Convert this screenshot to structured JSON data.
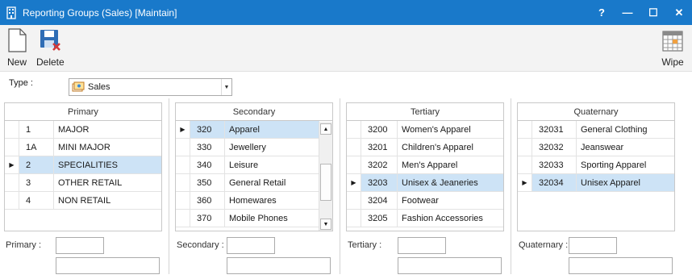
{
  "window": {
    "title": "Reporting Groups (Sales) [Maintain]",
    "help_label": "?",
    "minimize_label": "—",
    "maximize_label": "☐",
    "close_label": "✕"
  },
  "toolbar": {
    "new_label": "New",
    "delete_label": "Delete",
    "wipe_label": "Wipe"
  },
  "type": {
    "label": "Type :",
    "value": "Sales"
  },
  "primary": {
    "header": "Primary",
    "rows": [
      {
        "code": "1",
        "name": "MAJOR"
      },
      {
        "code": "1A",
        "name": "MINI MAJOR"
      },
      {
        "code": "2",
        "name": "SPECIALITIES"
      },
      {
        "code": "3",
        "name": "OTHER RETAIL"
      },
      {
        "code": "4",
        "name": "NON RETAIL"
      }
    ],
    "selected_index": 2,
    "field_label": "Primary :",
    "code_value": "",
    "desc_value": ""
  },
  "secondary": {
    "header": "Secondary",
    "rows": [
      {
        "code": "320",
        "name": "Apparel"
      },
      {
        "code": "330",
        "name": "Jewellery"
      },
      {
        "code": "340",
        "name": "Leisure"
      },
      {
        "code": "350",
        "name": "General Retail"
      },
      {
        "code": "360",
        "name": "Homewares"
      },
      {
        "code": "370",
        "name": "Mobile Phones"
      }
    ],
    "selected_index": 0,
    "field_label": "Secondary :",
    "code_value": "",
    "desc_value": ""
  },
  "tertiary": {
    "header": "Tertiary",
    "rows": [
      {
        "code": "3200",
        "name": "Women's Apparel"
      },
      {
        "code": "3201",
        "name": "Children's Apparel"
      },
      {
        "code": "3202",
        "name": "Men's Apparel"
      },
      {
        "code": "3203",
        "name": "Unisex & Jeaneries"
      },
      {
        "code": "3204",
        "name": "Footwear"
      },
      {
        "code": "3205",
        "name": "Fashion Accessories"
      }
    ],
    "selected_index": 3,
    "field_label": "Tertiary :",
    "code_value": "",
    "desc_value": ""
  },
  "quaternary": {
    "header": "Quaternary",
    "rows": [
      {
        "code": "32031",
        "name": "General Clothing"
      },
      {
        "code": "32032",
        "name": "Jeanswear"
      },
      {
        "code": "32033",
        "name": "Sporting Apparel"
      },
      {
        "code": "32034",
        "name": "Unisex Apparel"
      }
    ],
    "selected_index": 3,
    "field_label": "Quaternary :",
    "code_value": "",
    "desc_value": ""
  },
  "icons": {
    "app": "building-icon",
    "new": "new-document-icon",
    "delete": "delete-disk-icon",
    "wipe": "calendar-grid-icon",
    "type_value": "sales-icon",
    "row_indicator": "row-pointer-icon",
    "scroll_up": "scroll-up-arrow-icon",
    "scroll_down": "scroll-down-arrow-icon",
    "combo": "chevron-down-icon"
  },
  "colors": {
    "titlebar": "#1979ca",
    "selection": "#cde3f6",
    "ribbon": "#f3f3f3"
  }
}
